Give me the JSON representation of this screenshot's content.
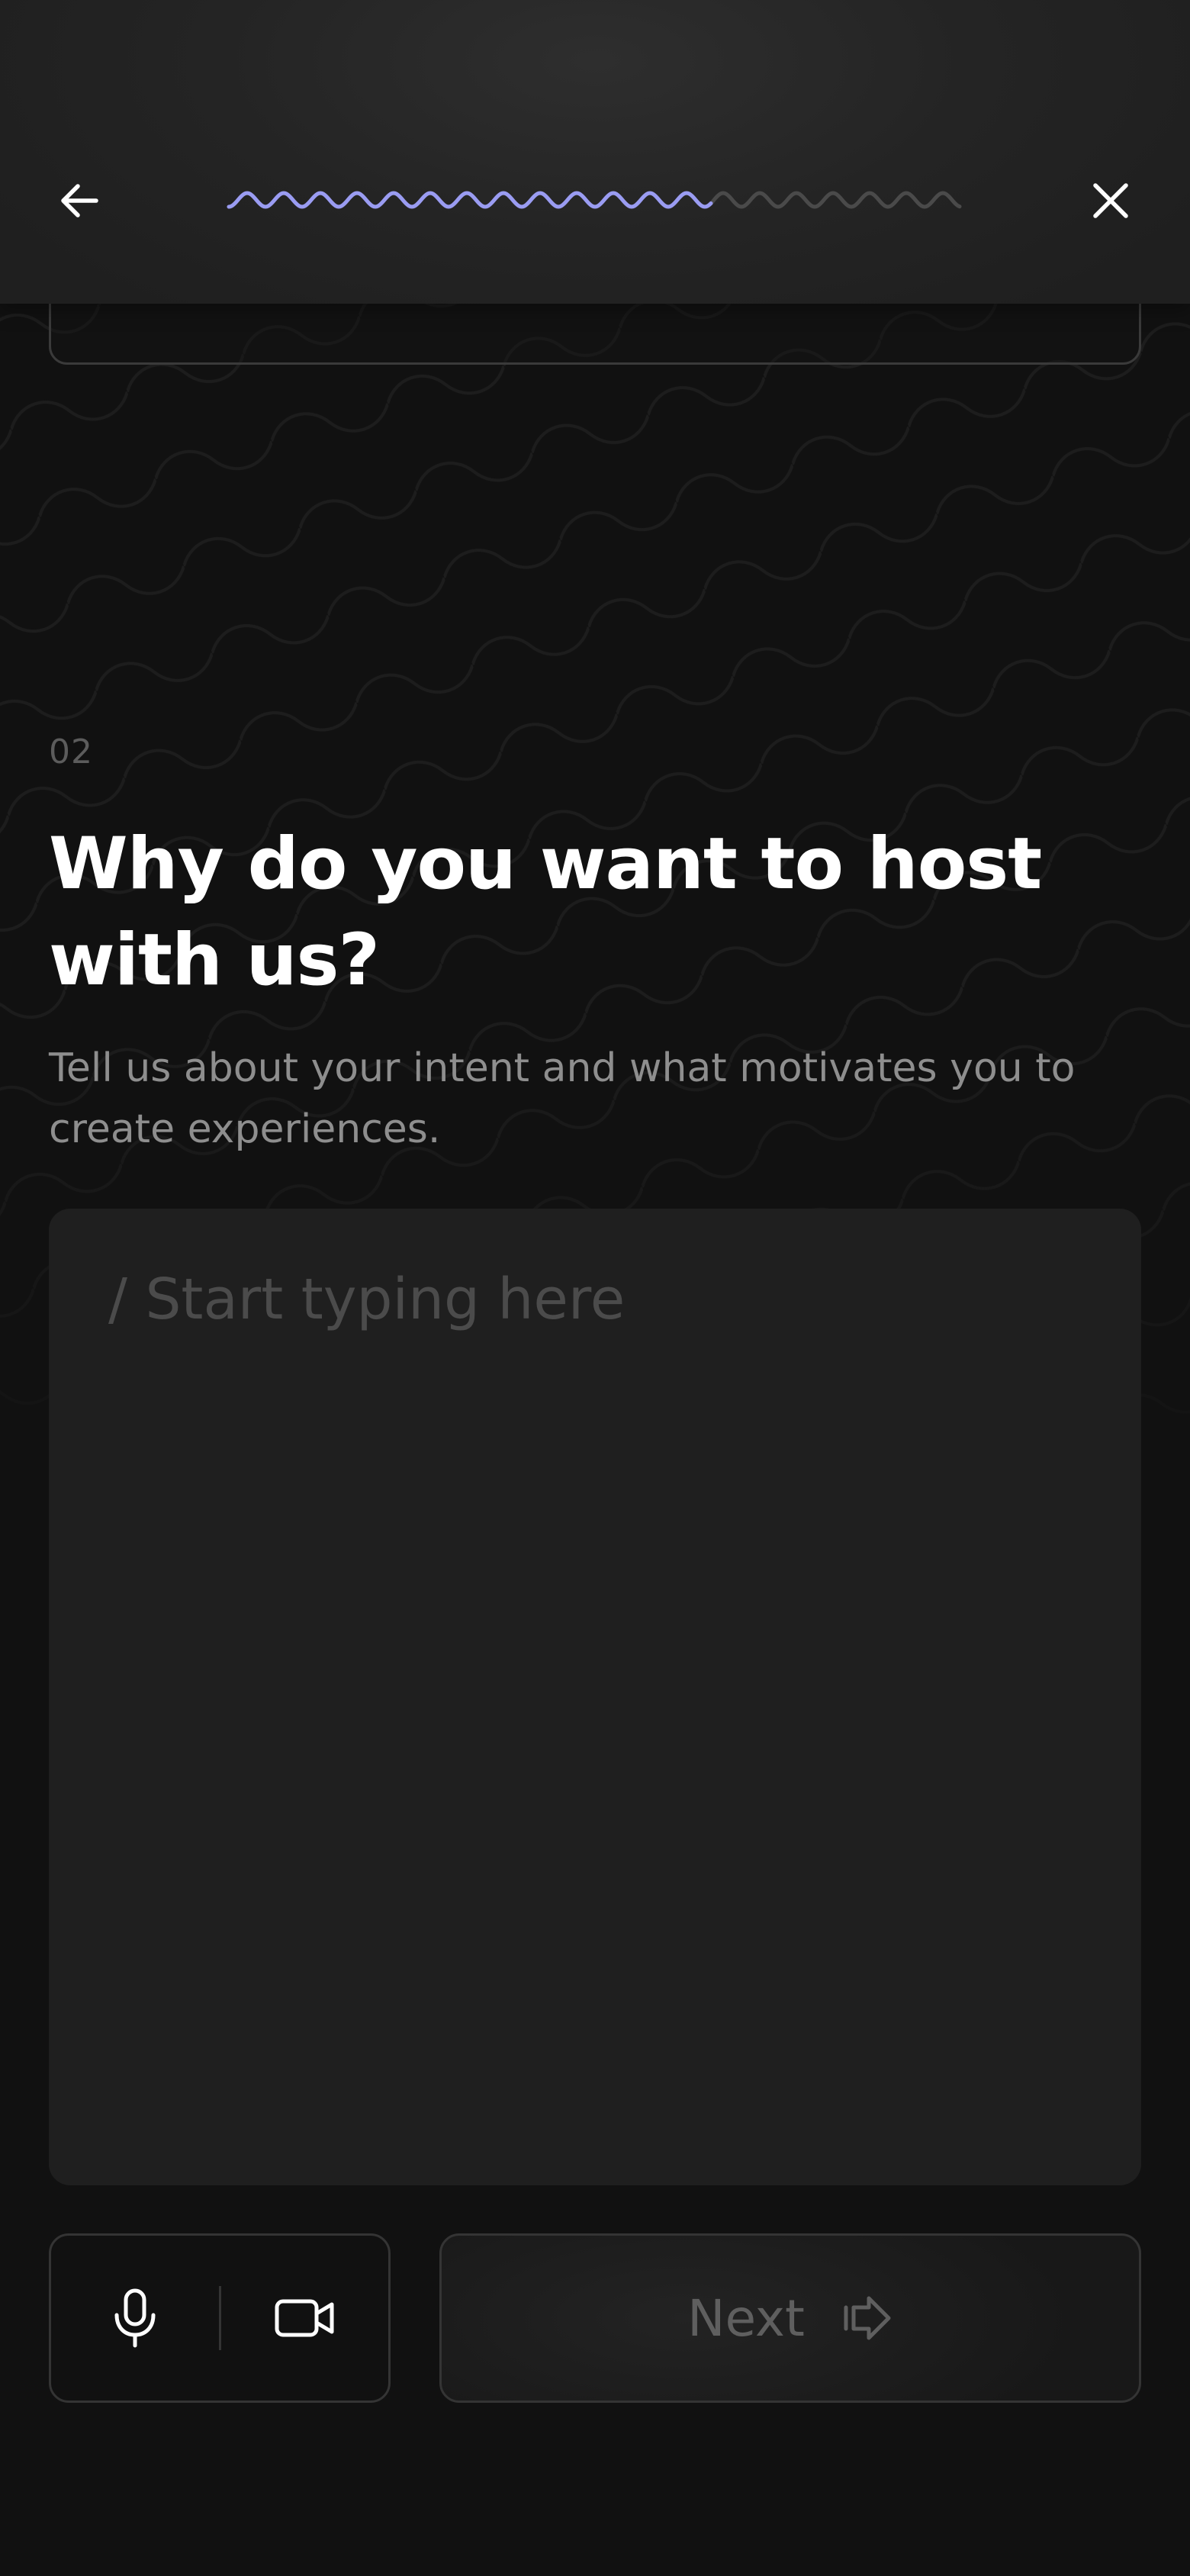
{
  "header": {
    "back_icon": "arrow-left-icon",
    "close_icon": "close-icon",
    "progress": {
      "completed_fraction": 0.66,
      "active_color": "#9a9cf2",
      "inactive_color": "#4a4a4a"
    }
  },
  "question": {
    "number": "02",
    "title": "Why do you want to host with us?",
    "subtitle": "Tell us about your intent and what motivates you to create experiences.",
    "placeholder": "/ Start typing here"
  },
  "footer": {
    "mic_icon": "microphone-icon",
    "video_icon": "video-camera-icon",
    "next_label": "Next",
    "next_icon": "arrow-right-outline-icon"
  },
  "colors": {
    "background": "#111111",
    "panel": "#1f1f1f",
    "accent": "#9a9cf2"
  }
}
